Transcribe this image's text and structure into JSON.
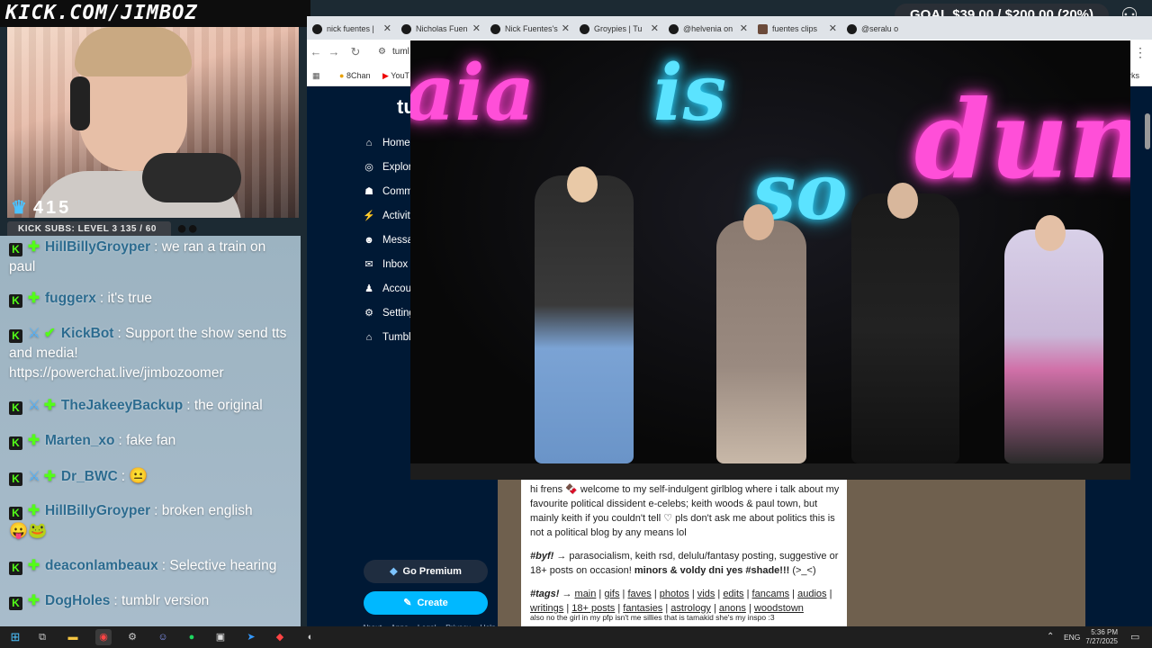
{
  "overlay": {
    "url_text": "KICK.COM/JIMBOZ",
    "goal_text": "GOAL $39.00 / $200.00 (20%)",
    "goal_progress": 0.2,
    "sub_count": "415",
    "kick_subs_text": "KICK SUBS: LEVEL 3 135 / 60"
  },
  "chat": {
    "messages": [
      {
        "user": "HillBillyGroyper",
        "text": "we ran a train on paul"
      },
      {
        "user": "fuggerx",
        "text": "it's true"
      },
      {
        "user": "KickBot",
        "text": "Support the show send tts and media! https://powerchat.live/jimbozoomer"
      },
      {
        "user": "TheJakeeyBackup",
        "text": "the original"
      },
      {
        "user": "Marten_xo",
        "text": "fake fan"
      },
      {
        "user": "Dr_BWC",
        "text": ""
      },
      {
        "user": "HillBillyGroyper",
        "text": "broken english"
      },
      {
        "user": "deaconlambeaux",
        "text": "Selective hearing"
      },
      {
        "user": "DogHoles",
        "text": "tumblr version"
      }
    ]
  },
  "browser": {
    "tabs": [
      {
        "label": "nick fuentes |"
      },
      {
        "label": "Nicholas Fuen"
      },
      {
        "label": "Nick Fuentes's"
      },
      {
        "label": "Groypies | Tu"
      },
      {
        "label": "@helvenia on"
      },
      {
        "label": "fuentes clips"
      },
      {
        "label": "@seralu o"
      }
    ],
    "address": "tuml",
    "bookmarks": [
      "8Chan",
      "YouT"
    ],
    "bookmarks_right": "arks"
  },
  "tumblr": {
    "logo": "tu",
    "nav": [
      {
        "label": "Home",
        "icon": "home-icon"
      },
      {
        "label": "Explore",
        "icon": "explore-icon"
      },
      {
        "label": "Comm",
        "icon": "communities-icon"
      },
      {
        "label": "Activity",
        "icon": "activity-icon"
      },
      {
        "label": "Messa",
        "icon": "messages-icon"
      },
      {
        "label": "Inbox",
        "icon": "inbox-icon"
      },
      {
        "label": "Accoun",
        "icon": "account-icon"
      },
      {
        "label": "Setting",
        "icon": "settings-icon"
      },
      {
        "label": "Tumbl",
        "icon": "tumblr-mart-icon"
      }
    ],
    "premium_label": "Go Premium",
    "create_label": "Create",
    "footer": [
      "About",
      "Apps",
      "Legal",
      "Privacy",
      "Help"
    ],
    "blog": {
      "intro": "hi frens 🍫 welcome to my self-indulgent girlblog where i talk about my favourite political dissident e-celebs; keith woods & paul town, but mainly keith if you couldn't tell ♡ pls don't ask me about politics this is not a political blog by any means lol",
      "byf_label": "#byf!",
      "byf_text": " → parasocialism, keith rsd, delulu/fantasy posting, suggestive or 18+ posts on occasion! ",
      "byf_bold": "minors & voldy dni yes #shade!!!",
      "byf_tail": " (>_<)",
      "tags_label": "#tags!",
      "tags_arrow": " → ",
      "tags": [
        "main",
        "gifs",
        "faves",
        "photos",
        "vids",
        "edits",
        "fancams",
        "audios",
        "writings",
        "18+ posts",
        "fantasies",
        "astrology",
        "anons",
        "woodstown"
      ],
      "footnote": "also no the girl in my pfp isn't me sillies that is tamakid she's my inspo :3"
    }
  },
  "video": {
    "neon_line1_a": "aia",
    "neon_line1_b": "is",
    "neon_line2_a": "so",
    "neon_line2_b": "dun"
  },
  "taskbar": {
    "lang": "ENG",
    "time": "5:36 PM",
    "date": "7/27/2025"
  },
  "colors": {
    "kick_green": "#53fc18",
    "tumblr_navy": "#001935",
    "create_blue": "#00b8ff",
    "neon_pink": "#ff4fd8",
    "neon_blue": "#5be3ff"
  }
}
